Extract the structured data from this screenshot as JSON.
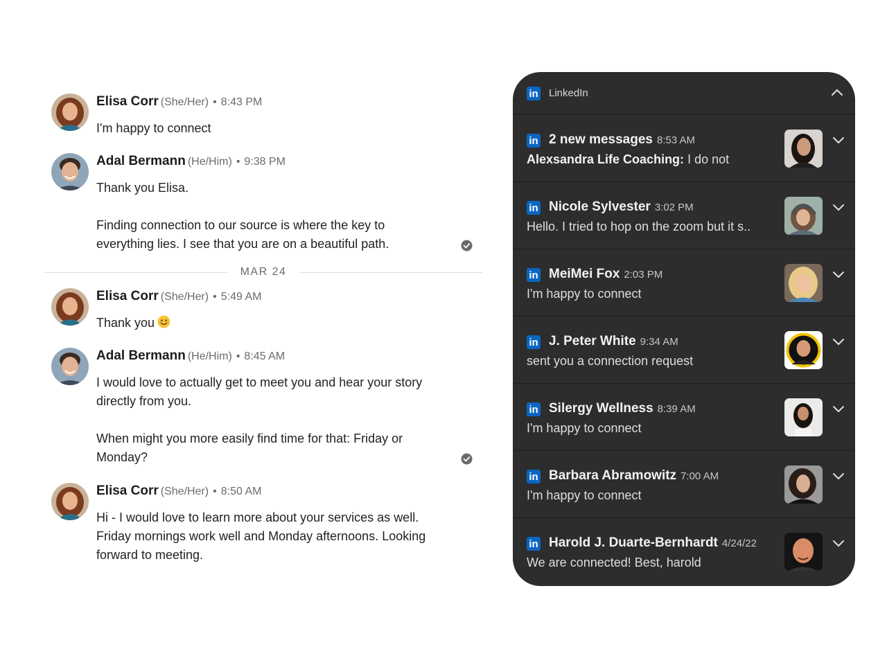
{
  "chat": {
    "messages": [
      {
        "name": "Elisa Corr",
        "pronouns": "(She/Her)",
        "time": "8:43 PM",
        "paragraphs": [
          "I'm happy to connect"
        ]
      },
      {
        "name": "Adal Bermann",
        "pronouns": "(He/Him)",
        "time": "9:38 PM",
        "paragraphs": [
          "Thank you Elisa.",
          "Finding connection to our source is where the key to everything lies. I see that you are on a beautiful path."
        ],
        "read": true
      },
      {
        "name": "Elisa Corr",
        "pronouns": "(She/Her)",
        "time": "5:49 AM",
        "paragraphs": [
          "Thank you"
        ],
        "emoji": "smiling-face"
      },
      {
        "name": "Adal Bermann",
        "pronouns": "(He/Him)",
        "time": "8:45 AM",
        "paragraphs": [
          "I would love to actually get to meet you and hear your story directly from you.",
          "When might you more easily find time for that: Friday or Monday?"
        ],
        "read": true
      },
      {
        "name": "Elisa Corr",
        "pronouns": "(She/Her)",
        "time": "8:50 AM",
        "paragraphs": [
          "Hi - I would love to learn more about your services as well. Friday mornings work well and Monday afternoons. Looking forward to meeting."
        ]
      }
    ],
    "separator": "•",
    "date_divider": "MAR 24",
    "read_icon": "check-circle-icon"
  },
  "notifications": {
    "app_name": "LinkedIn",
    "app_icon": "linkedin-icon",
    "logo_text": "in",
    "collapse_icon": "chevron-up-icon",
    "expand_icon": "chevron-down-icon",
    "brand_color": "#0a66c2",
    "panel_color": "#2d2d2e",
    "items": [
      {
        "title": "2 new messages",
        "time": "8:53 AM",
        "bold_prefix": "Alexsandra Life Coaching:",
        "text": "I do not"
      },
      {
        "title": "Nicole Sylvester",
        "time": "3:02 PM",
        "bold_prefix": "",
        "text": "Hello. I tried to hop on the zoom but it s.."
      },
      {
        "title": "MeiMei Fox",
        "time": "2:03 PM",
        "bold_prefix": "",
        "text": "I'm happy to connect"
      },
      {
        "title": "J. Peter White",
        "time": "9:34 AM",
        "bold_prefix": "",
        "text": "sent you a connection request"
      },
      {
        "title": "Silergy Wellness",
        "time": "8:39 AM",
        "bold_prefix": "",
        "text": "I'm happy to connect"
      },
      {
        "title": "Barbara Abramowitz",
        "time": "7:00 AM",
        "bold_prefix": "",
        "text": "I'm happy to connect"
      },
      {
        "title": "Harold J. Duarte-Bernhardt",
        "time": "4/24/22",
        "bold_prefix": "",
        "text": "We are connected! Best, harold"
      }
    ]
  }
}
